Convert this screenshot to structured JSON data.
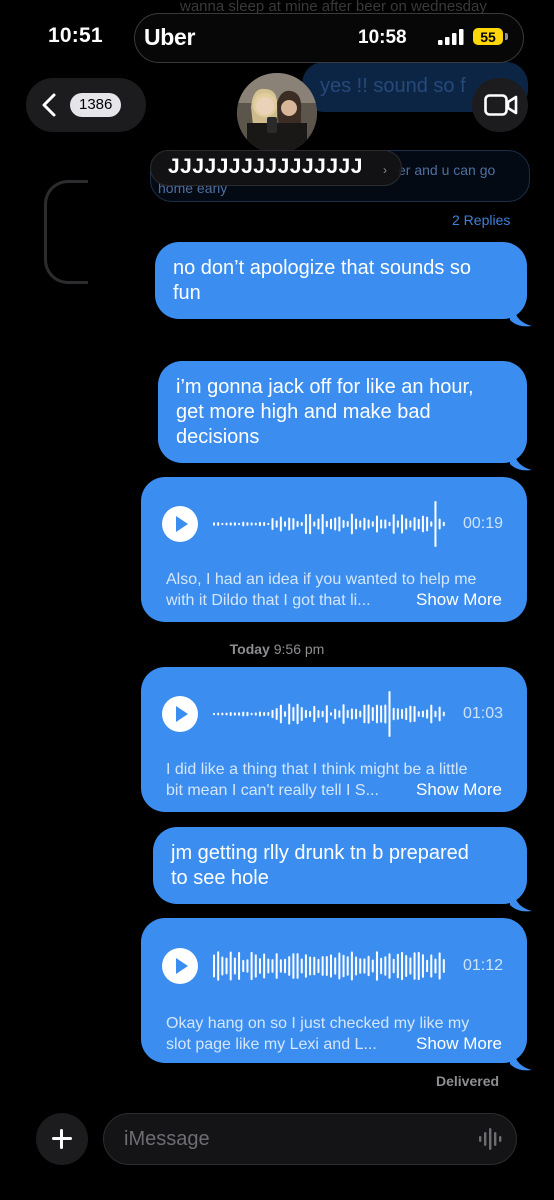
{
  "status_bar": {
    "time": "10:51",
    "live_activity_app": "Uber",
    "live_activity_time": "10:58",
    "battery": "55"
  },
  "background_ghosts": {
    "top_text": "wanna sleep at mine after beer on wednesday",
    "right_bubble": "yes !! sound so f",
    "left_text_1": "er and u can go",
    "left_text_2": "home early",
    "replies": "2 Replies"
  },
  "header": {
    "back_count": "1386",
    "contact_name": "JJJJJJJJJJJJJJJJ",
    "name_chevron": "›",
    "video_icon": "video-camera-icon"
  },
  "messages": [
    {
      "type": "text",
      "text_lines": [
        "no don’t apologize that sounds so",
        "fun"
      ]
    },
    {
      "type": "text",
      "text_lines": [
        "i’m gonna jack off for like an hour,",
        "get more high and make bad",
        "decisions"
      ]
    },
    {
      "type": "audio",
      "duration": "00:19",
      "transcript_lines": [
        "Also, I had an idea if you wanted to help me",
        "with it Dildo that I got that li..."
      ],
      "show_more": "Show More"
    },
    {
      "type": "audio",
      "duration": "01:03",
      "transcript_lines": [
        "I did like a thing that I think might be a little",
        "bit mean I can't really tell I S..."
      ],
      "show_more": "Show More"
    },
    {
      "type": "text",
      "text_lines": [
        "jm getting rlly drunk tn b prepared",
        "to see hole"
      ]
    },
    {
      "type": "audio",
      "duration": "01:12",
      "transcript_lines": [
        "Okay hang on so I just checked my like my",
        "slot page like my Lexi and L..."
      ],
      "show_more": "Show More"
    }
  ],
  "timestamp": {
    "day": "Today",
    "time": "9:56 pm"
  },
  "delivered": "Delivered",
  "input": {
    "placeholder": "iMessage"
  },
  "colors": {
    "bubble": "#3b8ef0",
    "background": "#000000",
    "battery": "#ffd60a",
    "link": "#3d82d8"
  }
}
